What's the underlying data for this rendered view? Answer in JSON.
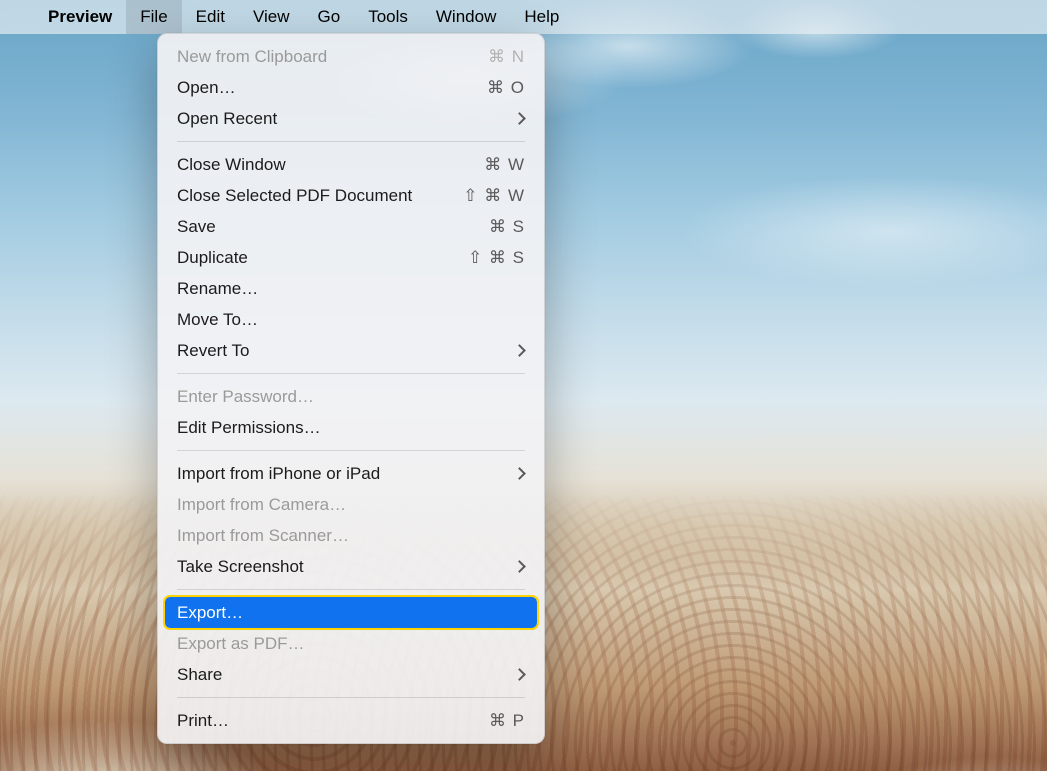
{
  "menubar": {
    "app_name": "Preview",
    "items": [
      "File",
      "Edit",
      "View",
      "Go",
      "Tools",
      "Window",
      "Help"
    ],
    "open_index": 0
  },
  "file_menu": {
    "groups": [
      [
        {
          "id": "new-from-clipboard",
          "label": "New from Clipboard",
          "shortcut": "⌘ N",
          "disabled": true
        },
        {
          "id": "open",
          "label": "Open…",
          "shortcut": "⌘ O"
        },
        {
          "id": "open-recent",
          "label": "Open Recent",
          "submenu": true
        }
      ],
      [
        {
          "id": "close-window",
          "label": "Close Window",
          "shortcut": "⌘ W"
        },
        {
          "id": "close-selected-pdf",
          "label": "Close Selected PDF Document",
          "shortcut": "⇧ ⌘ W"
        },
        {
          "id": "save",
          "label": "Save",
          "shortcut": "⌘ S"
        },
        {
          "id": "duplicate",
          "label": "Duplicate",
          "shortcut": "⇧ ⌘ S"
        },
        {
          "id": "rename",
          "label": "Rename…"
        },
        {
          "id": "move-to",
          "label": "Move To…"
        },
        {
          "id": "revert-to",
          "label": "Revert To",
          "submenu": true
        }
      ],
      [
        {
          "id": "enter-password",
          "label": "Enter Password…",
          "disabled": true
        },
        {
          "id": "edit-permissions",
          "label": "Edit Permissions…"
        }
      ],
      [
        {
          "id": "import-iphone",
          "label": "Import from iPhone or iPad",
          "submenu": true
        },
        {
          "id": "import-camera",
          "label": "Import from Camera…",
          "disabled": true
        },
        {
          "id": "import-scanner",
          "label": "Import from Scanner…",
          "disabled": true
        },
        {
          "id": "take-screenshot",
          "label": "Take Screenshot",
          "submenu": true
        }
      ],
      [
        {
          "id": "export",
          "label": "Export…",
          "highlight": true
        },
        {
          "id": "export-as-pdf",
          "label": "Export as PDF…",
          "disabled": true
        },
        {
          "id": "share",
          "label": "Share",
          "submenu": true
        }
      ],
      [
        {
          "id": "print",
          "label": "Print…",
          "shortcut": "⌘ P"
        }
      ]
    ]
  }
}
